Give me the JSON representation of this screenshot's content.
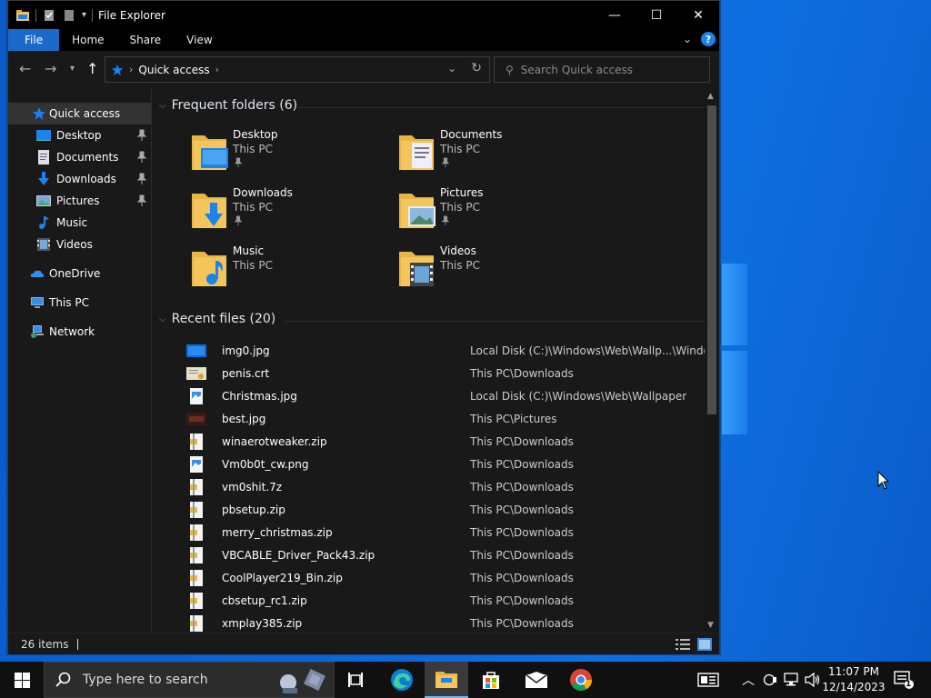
{
  "window": {
    "title": "File Explorer",
    "controls": {
      "minimize": "—",
      "maximize": "☐",
      "close": "✕"
    }
  },
  "ribbon": {
    "tabs": [
      "File",
      "Home",
      "Share",
      "View"
    ]
  },
  "address": {
    "crumb": "Quick access",
    "search_placeholder": "Search Quick access"
  },
  "nav_pane": {
    "items": [
      {
        "label": "Quick access",
        "icon": "star-icon",
        "pinned": false,
        "selected": true
      },
      {
        "label": "Desktop",
        "icon": "desktop-folder-icon",
        "pinned": true
      },
      {
        "label": "Documents",
        "icon": "documents-folder-icon",
        "pinned": true
      },
      {
        "label": "Downloads",
        "icon": "downloads-folder-icon",
        "pinned": true
      },
      {
        "label": "Pictures",
        "icon": "pictures-folder-icon",
        "pinned": true
      },
      {
        "label": "Music",
        "icon": "music-folder-icon",
        "pinned": false
      },
      {
        "label": "Videos",
        "icon": "videos-folder-icon",
        "pinned": false
      },
      {
        "label": "OneDrive",
        "icon": "onedrive-icon"
      },
      {
        "label": "This PC",
        "icon": "this-pc-icon"
      },
      {
        "label": "Network",
        "icon": "network-icon"
      }
    ]
  },
  "frequent": {
    "header": "Frequent folders (6)",
    "folders": [
      {
        "name": "Desktop",
        "location": "This PC",
        "pinned": true,
        "icon": "desktop-folder-icon"
      },
      {
        "name": "Documents",
        "location": "This PC",
        "pinned": true,
        "icon": "documents-folder-icon"
      },
      {
        "name": "Downloads",
        "location": "This PC",
        "pinned": true,
        "icon": "downloads-folder-icon"
      },
      {
        "name": "Pictures",
        "location": "This PC",
        "pinned": true,
        "icon": "pictures-folder-icon"
      },
      {
        "name": "Music",
        "location": "This PC",
        "pinned": false,
        "icon": "music-folder-icon"
      },
      {
        "name": "Videos",
        "location": "This PC",
        "pinned": false,
        "icon": "videos-folder-icon"
      }
    ]
  },
  "recent": {
    "header": "Recent files (20)",
    "files": [
      {
        "name": "img0.jpg",
        "path": "Local Disk (C:)\\Windows\\Web\\Wallp...\\Windows",
        "icon": "wallpaper-thumb-icon"
      },
      {
        "name": "penis.crt",
        "path": "This PC\\Downloads",
        "icon": "certificate-file-icon"
      },
      {
        "name": "Christmas.jpg",
        "path": "Local Disk (C:)\\Windows\\Web\\Wallpaper",
        "icon": "image-file-icon"
      },
      {
        "name": "best.jpg",
        "path": "This PC\\Pictures",
        "icon": "image-thumb-icon"
      },
      {
        "name": "winaerotweaker.zip",
        "path": "This PC\\Downloads",
        "icon": "zip-file-icon"
      },
      {
        "name": "Vm0b0t_cw.png",
        "path": "This PC\\Downloads",
        "icon": "image-file-icon"
      },
      {
        "name": "vm0shit.7z",
        "path": "This PC\\Downloads",
        "icon": "archive-file-icon"
      },
      {
        "name": "pbsetup.zip",
        "path": "This PC\\Downloads",
        "icon": "zip-file-icon"
      },
      {
        "name": "merry_christmas.zip",
        "path": "This PC\\Downloads",
        "icon": "zip-file-icon"
      },
      {
        "name": "VBCABLE_Driver_Pack43.zip",
        "path": "This PC\\Downloads",
        "icon": "zip-file-icon"
      },
      {
        "name": "CoolPlayer219_Bin.zip",
        "path": "This PC\\Downloads",
        "icon": "zip-file-icon"
      },
      {
        "name": "cbsetup_rc1.zip",
        "path": "This PC\\Downloads",
        "icon": "zip-file-icon"
      },
      {
        "name": "xmplay385.zip",
        "path": "This PC\\Downloads",
        "icon": "zip-file-icon"
      }
    ]
  },
  "status": {
    "count": "26 items"
  },
  "taskbar": {
    "search_placeholder": "Type here to search",
    "time": "11:07 PM",
    "date": "12/14/2023",
    "notification_count": "1"
  },
  "colors": {
    "accent": "#1b6ac9",
    "folder_yellow": "#f3c55a",
    "window_bg": "#191919",
    "desktop_blue": "#0c63d4"
  }
}
